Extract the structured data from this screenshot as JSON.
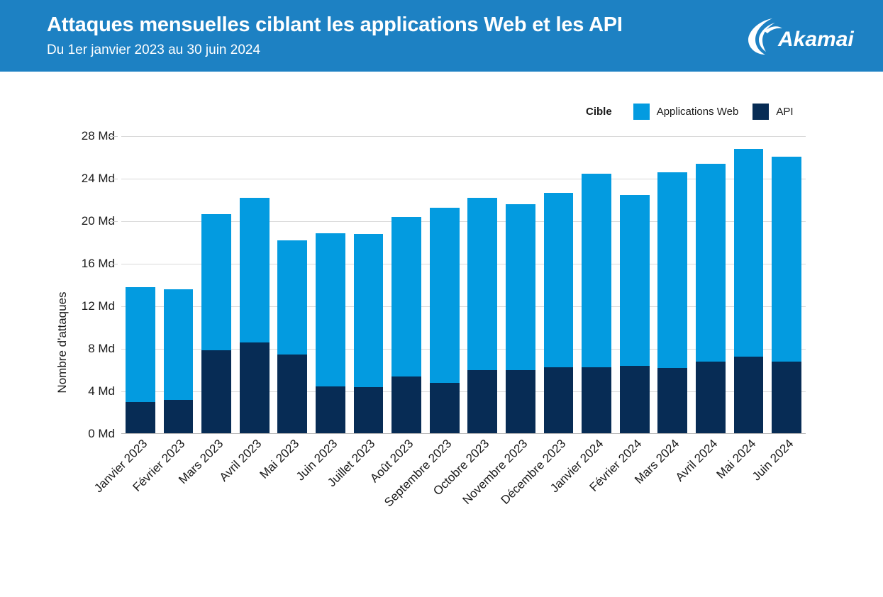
{
  "header": {
    "title": "Attaques mensuelles ciblant les applications Web et les API",
    "subtitle": "Du 1er janvier 2023 au 30 juin 2024",
    "logo_name": "akamai-logo",
    "background_color": "#1d81c3"
  },
  "legend": {
    "title": "Cible",
    "items": [
      {
        "label": "Applications Web",
        "color": "#039be0"
      },
      {
        "label": "API",
        "color": "#072c55"
      }
    ]
  },
  "chart_data": {
    "type": "bar",
    "subtype": "stacked",
    "title": "Attaques mensuelles ciblant les applications Web et les API",
    "subtitle": "Du 1er janvier 2023 au 30 juin 2024",
    "xlabel": "",
    "ylabel": "Nombre d'attaques",
    "ylim": [
      0,
      28
    ],
    "yticks": [
      0,
      4,
      8,
      12,
      16,
      20,
      24,
      28
    ],
    "ytick_labels": [
      "0 Md",
      "4 Md",
      "8 Md",
      "12 Md",
      "16 Md",
      "20 Md",
      "24 Md",
      "28 Md"
    ],
    "unit": "Md",
    "grid": true,
    "legend_position": "top-right",
    "categories": [
      "Janvier 2023",
      "Février 2023",
      "Mars 2023",
      "Avril 2023",
      "Mai 2023",
      "Juin 2023",
      "Juillet 2023",
      "Août 2023",
      "Septembre 2023",
      "Octobre 2023",
      "Novembre 2023",
      "Décembre 2023",
      "Janvier 2024",
      "Février 2024",
      "Mars 2024",
      "Avril 2024",
      "Mai 2024",
      "Juin 2024"
    ],
    "series": [
      {
        "name": "API",
        "color": "#072c55",
        "values": [
          3.0,
          3.2,
          7.9,
          8.6,
          7.5,
          4.5,
          4.4,
          5.4,
          4.8,
          6.0,
          6.0,
          6.3,
          6.3,
          6.4,
          6.2,
          6.8,
          7.3,
          6.8
        ]
      },
      {
        "name": "Applications Web",
        "color": "#039be0",
        "values": [
          10.8,
          10.4,
          12.8,
          13.6,
          10.7,
          14.4,
          14.4,
          15.0,
          16.5,
          16.2,
          15.6,
          16.4,
          18.2,
          16.1,
          18.4,
          18.6,
          19.5,
          19.3
        ]
      }
    ],
    "totals": [
      13.8,
      13.6,
      20.7,
      22.2,
      18.2,
      18.9,
      18.8,
      20.4,
      21.3,
      22.2,
      21.6,
      22.7,
      24.5,
      22.5,
      24.6,
      25.4,
      26.8,
      26.1
    ]
  }
}
